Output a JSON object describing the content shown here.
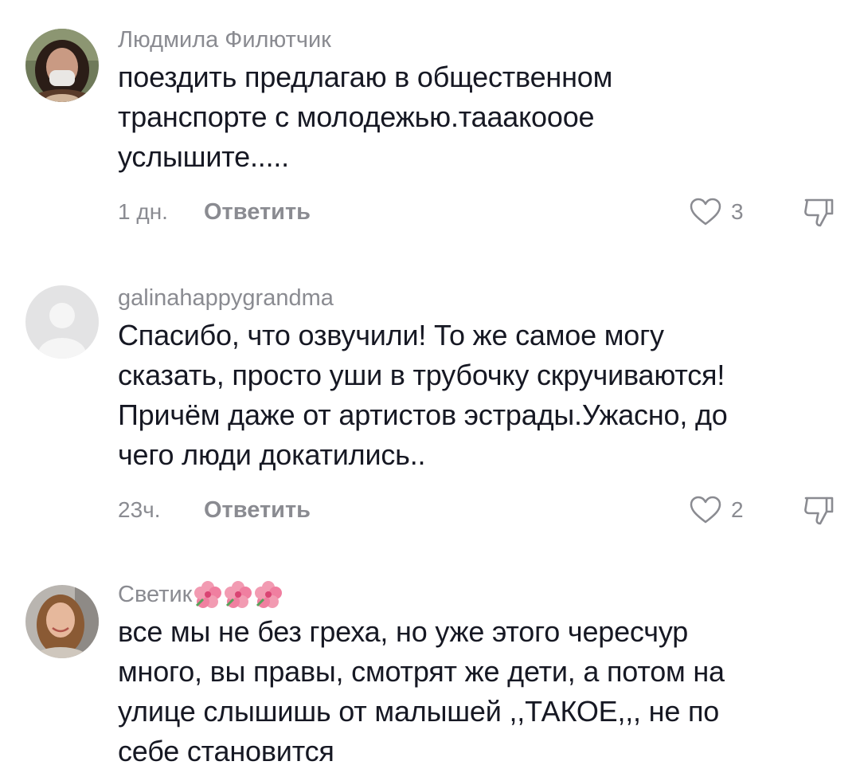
{
  "comments": [
    {
      "username": "Людмила Филютчик",
      "lines": [
        "поездить предлагаю в общественном",
        "транспорте с молодежью.тааакооое",
        "услышите....."
      ],
      "time": "1 дн.",
      "reply_label": "Ответить",
      "likes": "3",
      "avatar": "photo-woman-mask"
    },
    {
      "username": "galinahappygrandma",
      "lines": [
        "Спасибо, что озвучили! То же самое могу",
        "сказать, просто уши в трубочку скручиваются!",
        "Причём даже от артистов эстрады.Ужасно, до",
        "чего люди докатились.."
      ],
      "time": "23ч.",
      "reply_label": "Ответить",
      "likes": "2",
      "avatar": "default-avatar"
    },
    {
      "username": "Светик",
      "username_emoji": [
        "hibiscus-emoji",
        "hibiscus-emoji",
        "hibiscus-emoji"
      ],
      "lines": [
        "все мы не без греха, но уже этого чересчур",
        "много, вы правы, смотрят же дети, а потом на",
        "улице слышишь от малышей ,,ТАКОЕ,,, не по",
        "себе становится"
      ],
      "avatar": "photo-woman-smiling"
    }
  ],
  "icons": {
    "like": "heart-outline-icon",
    "dislike": "thumbs-down-icon"
  },
  "colors": {
    "text": "#161823",
    "secondary": "#8a8b91",
    "background": "#ffffff"
  }
}
